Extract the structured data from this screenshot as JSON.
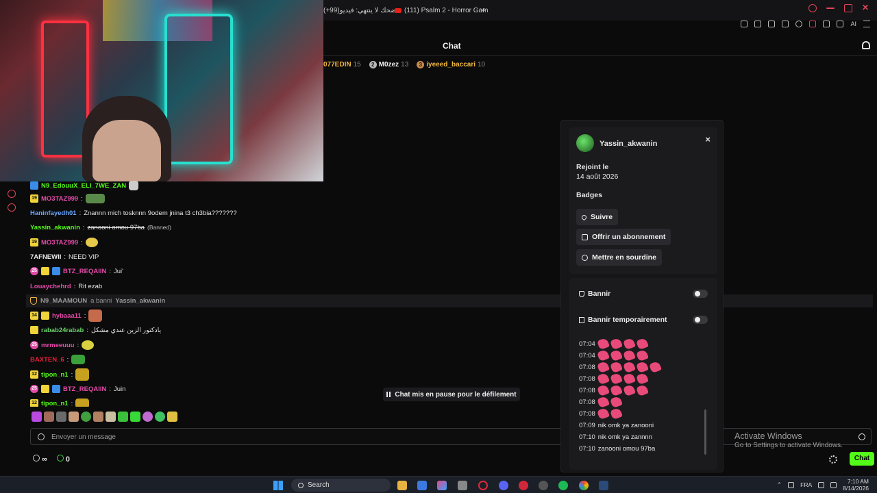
{
  "browser": {
    "tabs": [
      {
        "label": "(+99)ضحك لا ينتهي: فيديو"
      },
      {
        "label": "(111) Psalm 2 - Horror Gam"
      }
    ],
    "new_tab": "+"
  },
  "toolbar": {
    "ai_label": "AI"
  },
  "chat": {
    "title": "Chat",
    "leaderboard": [
      {
        "name": "077EDIN",
        "count": "15",
        "rank": ""
      },
      {
        "name": "M0zez",
        "count": "13",
        "rank": "2"
      },
      {
        "name": "iyeeed_baccari",
        "count": "10",
        "rank": "3"
      }
    ],
    "messages": [
      {
        "badge": "",
        "user": "N9_EdouuX_ELI_7WE_ZAN",
        "sep": "",
        "text": "",
        "user_color": "#53fc18"
      },
      {
        "badge": "19",
        "user": "MO3TAZ999",
        "sep": ":",
        "text": "",
        "user_color": "#e44aa8"
      },
      {
        "badge": "",
        "user": "Haninfayedh01",
        "sep": ":",
        "text": "Znannn mich tosknnn 9odem jnina t3 ch3bia???????",
        "user_color": "#6aa8ff"
      },
      {
        "badge": "",
        "user": "Yassin_akwanin",
        "sep": ":",
        "text": "zanooni omou 97ba",
        "banned": "(Banned)",
        "user_color": "#53fc18"
      },
      {
        "badge": "19",
        "user": "MO3TAZ999",
        "sep": ":",
        "text": "",
        "user_color": "#e44aa8"
      },
      {
        "badge": "",
        "user": "7AFNEWII",
        "sep": ":",
        "text": "NEED VIP",
        "user_color": "#e8e8e8"
      },
      {
        "badge": "25",
        "user": "BTZ_REQAIIN",
        "sep": ":",
        "text": "Jui'",
        "user_color": "#e44aa8"
      },
      {
        "badge": "",
        "user": "Louaychehrd",
        "sep": ":",
        "text": "Rit ezab",
        "user_color": "#e44aa8"
      },
      {
        "badge": "14",
        "user": "hybaaa11",
        "sep": ":",
        "text": "",
        "user_color": "#e44aa8"
      },
      {
        "badge": "",
        "user": "rabab24rabab",
        "sep": ":",
        "text": "يادكتور الزين عندي مشكل",
        "user_color": "#6ad06a"
      },
      {
        "badge": "25",
        "user": "mrmeeuuu",
        "sep": ":",
        "text": "",
        "user_color": "#e44aa8"
      },
      {
        "badge": "",
        "user": "BAXTEN_6",
        "sep": ":",
        "text": "",
        "user_color": "#e6203a"
      },
      {
        "badge": "12",
        "user": "tipon_n1",
        "sep": ":",
        "text": "",
        "user_color": "#53fc18"
      },
      {
        "badge": "25",
        "user": "BTZ_REQAIIN",
        "sep": ":",
        "text": "Juin",
        "user_color": "#e44aa8"
      },
      {
        "badge": "12",
        "user": "tipon_n1",
        "sep": ":",
        "text": "",
        "user_color": "#53fc18"
      }
    ],
    "mod_event": {
      "moderator": "N9_MAAMOUN",
      "action": "a banni",
      "target": "Yassin_akwanin"
    },
    "paused_label": "Chat mis en pause pour le défilement",
    "input_placeholder": "Envoyer un message",
    "points": [
      {
        "value": "∞"
      },
      {
        "value": "0"
      }
    ],
    "chat_button": "Chat"
  },
  "user_card": {
    "username": "Yassin_akwanin",
    "close": "×",
    "joined_label": "Rejoint le",
    "joined_date": "14 août 2026",
    "badges_label": "Badges",
    "follow": "Suivre",
    "gift": "Offrir un abonnement",
    "mute": "Mettre en sourdine",
    "ban": "Bannir",
    "timeout": "Bannir temporairement",
    "history": [
      {
        "time": "07:04",
        "emotes": 4,
        "text": ""
      },
      {
        "time": "07:04",
        "emotes": 4,
        "text": ""
      },
      {
        "time": "07:08",
        "emotes": 5,
        "text": ""
      },
      {
        "time": "07:08",
        "emotes": 4,
        "text": ""
      },
      {
        "time": "07:08",
        "emotes": 4,
        "text": ""
      },
      {
        "time": "07:08",
        "emotes": 2,
        "text": ""
      },
      {
        "time": "07:08",
        "emotes": 2,
        "text": ""
      },
      {
        "time": "07:09",
        "emotes": 0,
        "text": "nik omk ya zanooni"
      },
      {
        "time": "07:10",
        "emotes": 0,
        "text": "nik omk ya zannnn"
      },
      {
        "time": "07:10",
        "emotes": 0,
        "text": "zanooni omou 97ba"
      }
    ]
  },
  "watermark": {
    "title": "Activate Windows",
    "subtitle": "Go to Settings to activate Windows."
  },
  "taskbar": {
    "search": "Search",
    "lang": "FRA",
    "time": "7:10 AM",
    "date": "8/14/2026"
  }
}
